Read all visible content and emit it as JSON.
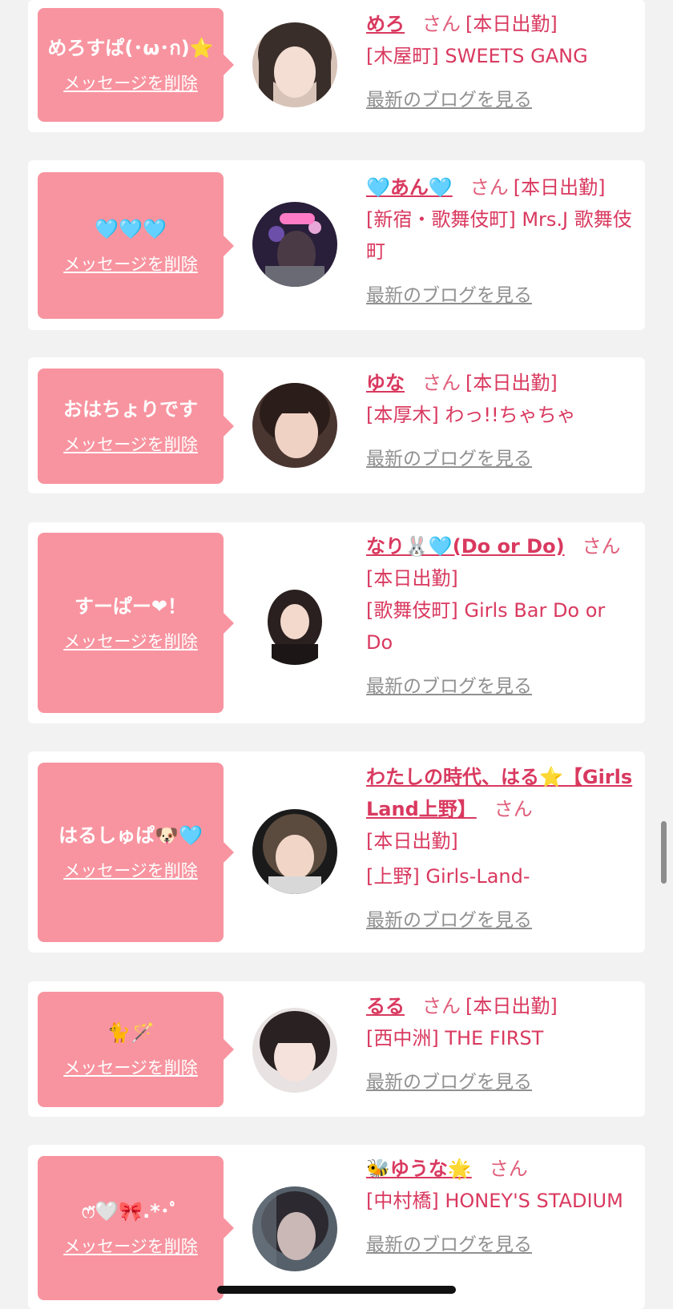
{
  "delete_label": "メッセージを削除",
  "san_label": "さん",
  "status_label": "[本日出勤]",
  "blog_label": "最新のブログを見る",
  "colors": {
    "bubble": "#f7949f",
    "name": "#d9395f",
    "blog": "#909090",
    "background": "#f2f2f2"
  },
  "cards": [
    {
      "message": "めろすぱ(･ω･ก)⭐️",
      "name": "めろ",
      "location": "[木屋町] SWEETS GANG",
      "has_status": true
    },
    {
      "message": "🩵🩵🩵",
      "name": "🩵あん🩵",
      "location": "[新宿・歌舞伎町] Mrs.J 歌舞伎町",
      "has_status": true
    },
    {
      "message": "おはちょりです",
      "name": "ゆな",
      "location": "[本厚木] わっ!!ちゃちゃ",
      "has_status": true
    },
    {
      "message": "すーぱー❤！",
      "name": "なり🐰🩵(Do or Do)",
      "location": "[歌舞伎町] Girls Bar Do or Do",
      "has_status": true
    },
    {
      "message": "はるしゅぱ🐶🩵",
      "name": "わたしの時代、はる⭐️【Girls Land上野】",
      "location": "[上野] Girls-Land-",
      "has_status": true
    },
    {
      "message": "🐈🪄",
      "name": "るる",
      "location": "[西中洲] THE FIRST",
      "has_status": true
    },
    {
      "message": "ෆ̈🤍🎀.*･ﾟ",
      "name": "🐝ゆうな🌟",
      "location": "[中村橋] HONEY'S STADIUM",
      "has_status": false
    }
  ]
}
